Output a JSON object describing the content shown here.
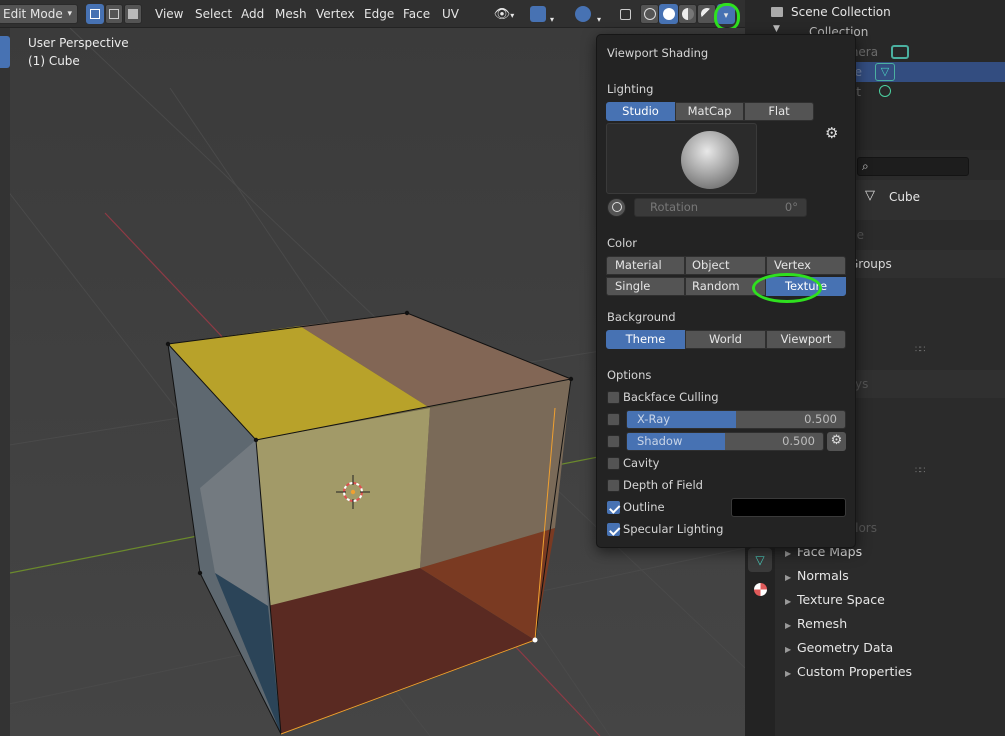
{
  "header": {
    "mode": "Edit Mode",
    "menus": [
      "View",
      "Select",
      "Add",
      "Mesh",
      "Vertex",
      "Edge",
      "Face",
      "UV"
    ]
  },
  "viewport": {
    "view_name": "User Perspective",
    "object_name": "(1) Cube"
  },
  "outliner": {
    "scene_collection": "Scene Collection",
    "collection": "Collection",
    "items": [
      "Camera",
      "Cube",
      "Light"
    ]
  },
  "properties": {
    "object_label": "Cube",
    "faded_labels": [
      "Cube",
      "Groups",
      "Shape Keys",
      "Vertex Colors"
    ],
    "sections": [
      "Face Maps",
      "Normals",
      "Texture Space",
      "Remesh",
      "Geometry Data",
      "Custom Properties"
    ]
  },
  "shading_popover": {
    "title": "Viewport Shading",
    "lighting_label": "Lighting",
    "lighting_options": [
      "Studio",
      "MatCap",
      "Flat"
    ],
    "lighting_selected": "Studio",
    "rotation_label": "Rotation",
    "rotation_value": "0°",
    "color_label": "Color",
    "color_options_row1": [
      "Material",
      "Object",
      "Vertex"
    ],
    "color_options_row2": [
      "Single",
      "Random",
      "Texture"
    ],
    "color_selected": "Texture",
    "background_label": "Background",
    "background_options": [
      "Theme",
      "World",
      "Viewport"
    ],
    "background_selected": "Theme",
    "options_label": "Options",
    "backface_culling": {
      "label": "Backface Culling",
      "checked": false
    },
    "xray": {
      "label": "X-Ray",
      "value": "0.500",
      "fraction": 0.5,
      "checked": false
    },
    "shadow": {
      "label": "Shadow",
      "value": "0.500",
      "fraction": 0.5,
      "checked": false
    },
    "cavity": {
      "label": "Cavity",
      "checked": false
    },
    "depth_of_field": {
      "label": "Depth of Field",
      "checked": false
    },
    "outline": {
      "label": "Outline",
      "checked": true,
      "color": "#000000"
    },
    "specular_lighting": {
      "label": "Specular Lighting",
      "checked": true
    }
  },
  "colors": {
    "accent": "#4772b3",
    "highlight_annotation": "#2fe01f"
  }
}
